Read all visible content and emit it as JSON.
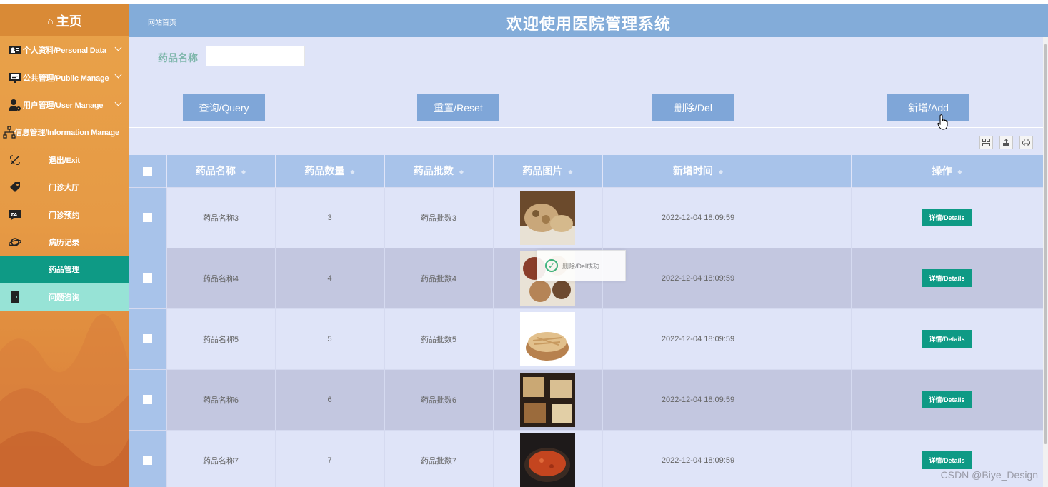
{
  "sidebar": {
    "home_label": "主页",
    "items": [
      {
        "label": "个人资料/Personal Data",
        "icon": "user-card-icon",
        "expandable": true
      },
      {
        "label": "公共管理/Public Manage",
        "icon": "monitor-icon",
        "expandable": true
      },
      {
        "label": "用户管理/User Manage",
        "icon": "user-gear-icon",
        "expandable": true
      },
      {
        "label": "信息管理/Information Manage",
        "icon": "org-tree-icon",
        "expandable": true
      },
      {
        "label": "退出/Exit",
        "icon": "exit-icon"
      },
      {
        "label": "门诊大厅",
        "icon": "tag-icon"
      },
      {
        "label": "门诊预约",
        "icon": "translate-icon"
      },
      {
        "label": "病历记录",
        "icon": "planet-icon"
      },
      {
        "label": "药品管理",
        "active": true
      },
      {
        "label": "问题咨询",
        "icon": "door-icon",
        "hover": true
      }
    ]
  },
  "header": {
    "breadcrumb": "网站首页",
    "title": "欢迎使用医院管理系统"
  },
  "search": {
    "label": "药品名称",
    "value": "",
    "placeholder": ""
  },
  "buttons": {
    "query": "查询/Query",
    "reset": "重置/Reset",
    "delete": "删除/Del",
    "add": "新增/Add"
  },
  "toolbar": {
    "icons": [
      "columns-filter-icon",
      "export-icon",
      "print-icon"
    ]
  },
  "table": {
    "headers": [
      "药品名称",
      "药品数量",
      "药品批数",
      "药品图片",
      "新增时间",
      "",
      "操作"
    ],
    "rows": [
      {
        "name": "药品名称3",
        "qty": "3",
        "batch": "药品批数3",
        "time": "2022-12-04 18:09:59",
        "action": "详情/Details"
      },
      {
        "name": "药品名称4",
        "qty": "4",
        "batch": "药品批数4",
        "time": "2022-12-04 18:09:59",
        "action": "详情/Details"
      },
      {
        "name": "药品名称5",
        "qty": "5",
        "batch": "药品批数5",
        "time": "2022-12-04 18:09:59",
        "action": "详情/Details"
      },
      {
        "name": "药品名称6",
        "qty": "6",
        "batch": "药品批数6",
        "time": "2022-12-04 18:09:59",
        "action": "详情/Details"
      },
      {
        "name": "药品名称7",
        "qty": "7",
        "batch": "药品批数7",
        "time": "2022-12-04 18:09:59",
        "action": "详情/Details"
      }
    ]
  },
  "toast": {
    "message": "删除/Del成功"
  },
  "watermark": "CSDN @Biye_Design",
  "colors": {
    "sidebar": "#e69a45",
    "header": "#83acd9",
    "accent_green": "#0e9a85",
    "button": "#7fa6d8",
    "table_header": "#a8c3ea"
  }
}
